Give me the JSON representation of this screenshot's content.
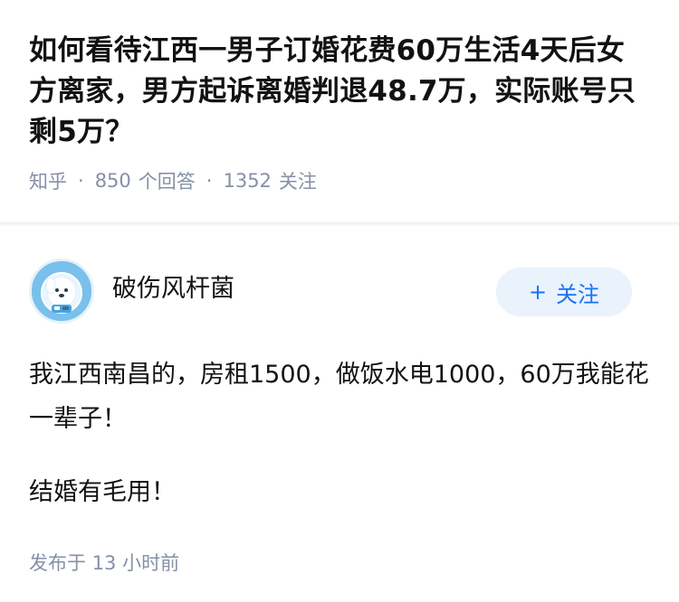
{
  "question": {
    "title": "如何看待江西一男子订婚花费60万生活4天后女方离家，男方起诉离婚判退48.7万，实际账号只剩5万？",
    "source": "知乎",
    "answer_count": "850",
    "answer_label": "个回答",
    "follower_count": "1352",
    "follower_label": "关注"
  },
  "answer": {
    "author_name": "破伤风杆菌",
    "follow_label": "关注",
    "follow_plus": "+",
    "paragraphs": [
      "我江西南昌的，房租1500，做饭水电1000，60万我能花一辈子！",
      "结婚有毛用！"
    ],
    "published_label": "发布于",
    "published_time": "13 小时前"
  },
  "colors": {
    "accent": "#1772f6",
    "meta": "#8590a6",
    "follow_bg": "#eaf2fc",
    "avatar_bg": "#6fb8e8"
  },
  "icons": {
    "avatar": "dog-astronaut-avatar",
    "separator": "middle-dot"
  }
}
